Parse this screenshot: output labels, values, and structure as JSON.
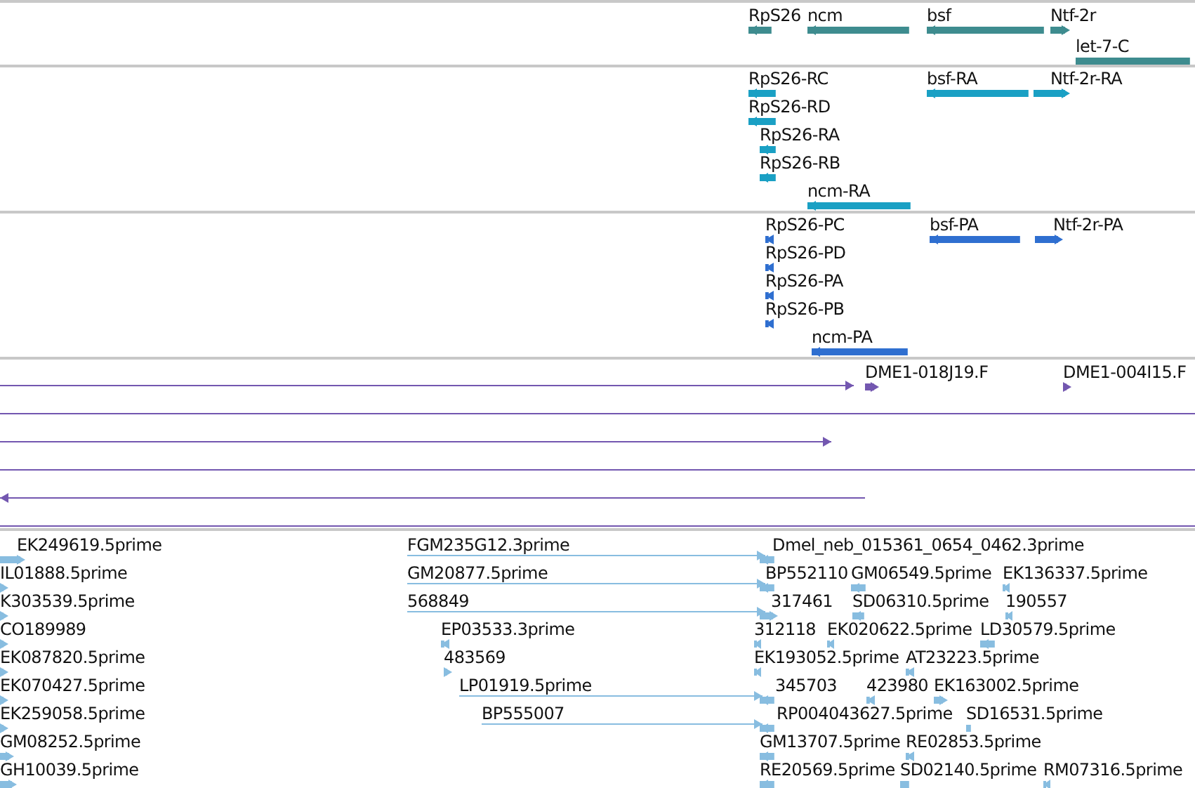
{
  "tracks": [
    {
      "kind": "gene",
      "features": [
        {
          "label": "RpS26",
          "kind": "reverse"
        },
        {
          "label": "ncm",
          "kind": "reverse"
        },
        {
          "label": "bsf",
          "kind": "reverse"
        },
        {
          "label": "Ntf-2r",
          "kind": "forward"
        },
        {
          "label": "let-7-C",
          "kind": "plain"
        }
      ]
    },
    {
      "kind": "transcript",
      "features": [
        {
          "label": "RpS26-RC",
          "kind": "reverse"
        },
        {
          "label": "RpS26-RD",
          "kind": "reverse"
        },
        {
          "label": "RpS26-RA",
          "kind": "reverse"
        },
        {
          "label": "RpS26-RB",
          "kind": "reverse"
        },
        {
          "label": "ncm-RA",
          "kind": "reverse"
        },
        {
          "label": "bsf-RA",
          "kind": "reverse"
        },
        {
          "label": "Ntf-2r-RA",
          "kind": "forward"
        }
      ]
    },
    {
      "kind": "protein",
      "features": [
        {
          "label": "RpS26-PC",
          "kind": "reverse"
        },
        {
          "label": "RpS26-PD",
          "kind": "reverse"
        },
        {
          "label": "RpS26-PA",
          "kind": "reverse"
        },
        {
          "label": "RpS26-PB",
          "kind": "reverse"
        },
        {
          "label": "ncm-PA",
          "kind": "reverse"
        },
        {
          "label": "bsf-PA",
          "kind": "reverse"
        },
        {
          "label": "Ntf-2r-PA",
          "kind": "forward"
        }
      ]
    },
    {
      "kind": "clone",
      "features": [
        {
          "kind": "forward"
        },
        {
          "label": "DME1-018J19.F",
          "kind": "forward"
        },
        {
          "label": "DME1-004I15.F",
          "kind": "forward"
        },
        {
          "kind": "plain"
        },
        {
          "kind": "forward"
        },
        {
          "kind": "plain"
        },
        {
          "kind": "reverse"
        },
        {
          "kind": "plain"
        }
      ]
    },
    {
      "kind": "est",
      "features": [
        {
          "label": "EK249619.5prime",
          "kind": "forward"
        },
        {
          "label": "IL01888.5prime",
          "kind": "forward"
        },
        {
          "label": "K303539.5prime",
          "kind": "forward"
        },
        {
          "label": "CO189989",
          "kind": "forward"
        },
        {
          "label": "EK087820.5prime",
          "kind": "forward"
        },
        {
          "label": "EK070427.5prime",
          "kind": "forward"
        },
        {
          "label": "EK259058.5prime",
          "kind": "forward"
        },
        {
          "label": "GM08252.5prime",
          "kind": "forward"
        },
        {
          "label": "GH10039.5prime",
          "kind": "forward"
        },
        {
          "label": "FGM235G12.3prime",
          "kind": "forward"
        },
        {
          "label": "GM20877.5prime",
          "kind": "forward"
        },
        {
          "label": "568849",
          "kind": "forward"
        },
        {
          "label": "EP03533.3prime",
          "kind": "reverse"
        },
        {
          "label": "483569",
          "kind": "forward"
        },
        {
          "label": "LP01919.5prime",
          "kind": "forward"
        },
        {
          "label": "BP555007",
          "kind": "forward"
        },
        {
          "label": "Dmel_neb_015361_0654_0462.3prime",
          "kind": "reverse"
        },
        {
          "label": "BP552110",
          "kind": "reverse"
        },
        {
          "label": "GM06549.5prime",
          "kind": "reverse"
        },
        {
          "label": "EK136337.5prime",
          "kind": "reverse"
        },
        {
          "label": "317461",
          "kind": "forward"
        },
        {
          "label": "SD06310.5prime",
          "kind": "reverse"
        },
        {
          "label": "190557",
          "kind": "reverse"
        },
        {
          "label": "312118",
          "kind": "reverse"
        },
        {
          "label": "EK020622.5prime",
          "kind": "reverse"
        },
        {
          "label": "LD30579.5prime",
          "kind": "reverse"
        },
        {
          "label": "EK193052.5prime",
          "kind": "reverse"
        },
        {
          "label": "AT23223.5prime",
          "kind": "reverse"
        },
        {
          "label": "345703",
          "kind": "reverse"
        },
        {
          "label": "423980",
          "kind": "reverse"
        },
        {
          "label": "EK163002.5prime",
          "kind": "forward"
        },
        {
          "label": "RP004043627.5prime",
          "kind": "reverse"
        },
        {
          "label": "SD16531.5prime",
          "kind": "plain"
        },
        {
          "label": "GM13707.5prime",
          "kind": "reverse"
        },
        {
          "label": "RE02853.5prime",
          "kind": "reverse"
        },
        {
          "label": "RE20569.5prime",
          "kind": "reverse"
        },
        {
          "label": "SD02140.5prime",
          "kind": "plain"
        },
        {
          "label": "RM07316.5prime",
          "kind": "reverse"
        }
      ]
    }
  ]
}
